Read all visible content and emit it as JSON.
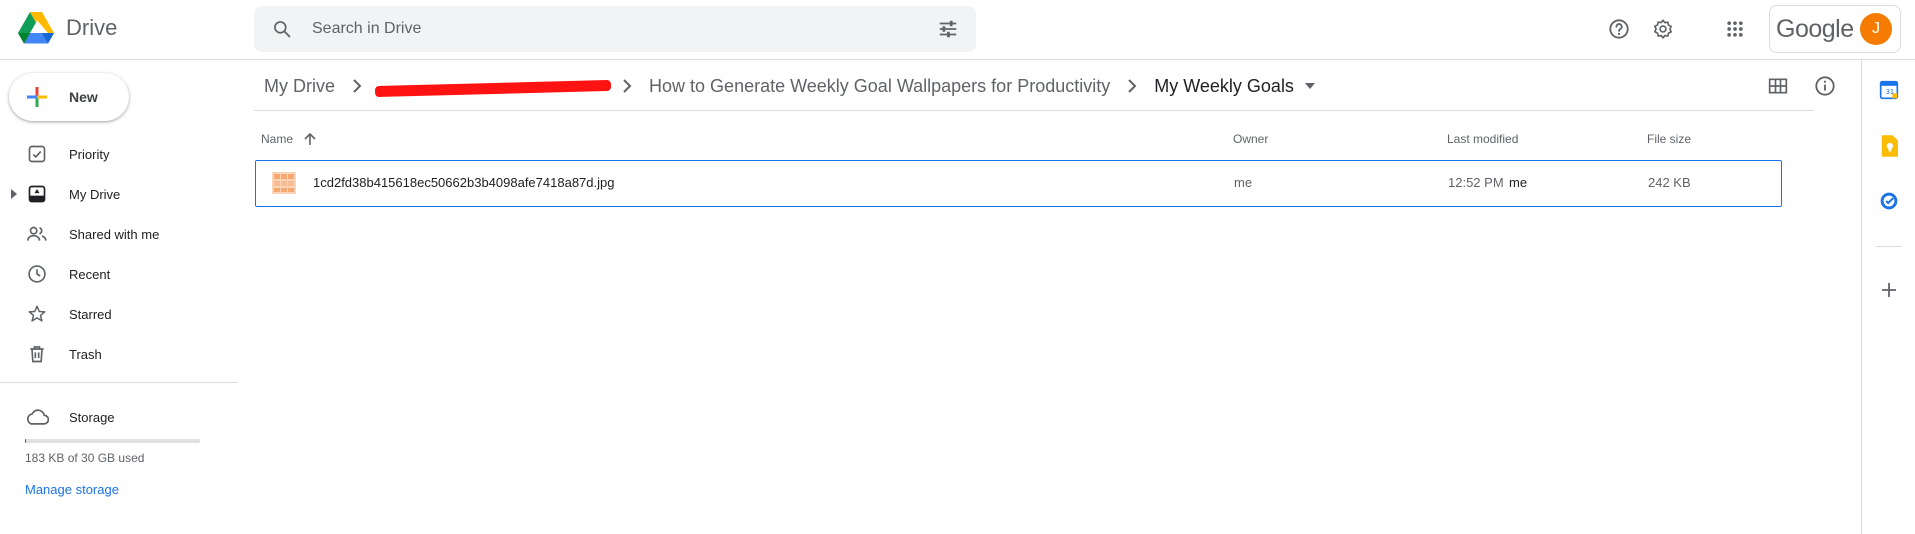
{
  "header": {
    "app_name": "Drive",
    "search_placeholder": "Search in Drive",
    "account_brand": "Google",
    "avatar_initial": "J"
  },
  "sidebar": {
    "new_label": "New",
    "items": [
      {
        "label": "Priority",
        "icon": "priority-icon"
      },
      {
        "label": "My Drive",
        "icon": "my-drive-icon"
      },
      {
        "label": "Shared with me",
        "icon": "shared-icon"
      },
      {
        "label": "Recent",
        "icon": "clock-icon"
      },
      {
        "label": "Starred",
        "icon": "star-icon"
      },
      {
        "label": "Trash",
        "icon": "trash-icon"
      }
    ],
    "storage": {
      "label": "Storage",
      "used_text": "183 KB of 30 GB used",
      "used_fraction": 6e-06,
      "manage_label": "Manage storage"
    }
  },
  "breadcrumb": {
    "items": [
      "My Drive",
      "How to Generate Weekly Goal Wallpapers for Productivity",
      "My Weekly Goals"
    ],
    "redacted_item": "[redacted folder]"
  },
  "table": {
    "columns": [
      "Name",
      "Owner",
      "Last modified",
      "File size"
    ],
    "rows": [
      {
        "name": "1cd2fd38b415618ec50662b3b4098afe7418a87d.jpg",
        "owner": "me",
        "modified": "12:52 PM",
        "modified_by": "me",
        "size": "242 KB"
      }
    ]
  },
  "colors": {
    "accent": "#1a73e8",
    "redaction": "#ff1212",
    "avatar": "#f57c00"
  }
}
